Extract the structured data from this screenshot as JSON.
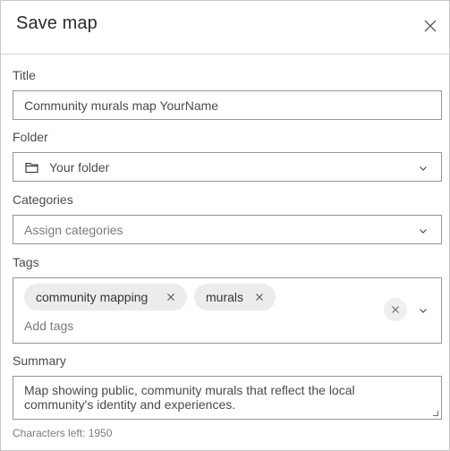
{
  "dialog": {
    "title": "Save map",
    "close_icon": "close-icon"
  },
  "form": {
    "title": {
      "label": "Title",
      "value": "Community murals map YourName"
    },
    "folder": {
      "label": "Folder",
      "icon": "folder-icon",
      "value": "Your folder"
    },
    "categories": {
      "label": "Categories",
      "placeholder": "Assign categories"
    },
    "tags": {
      "label": "Tags",
      "chips": [
        {
          "label": "community mapping"
        },
        {
          "label": "murals"
        }
      ],
      "placeholder": "Add tags"
    },
    "summary": {
      "label": "Summary",
      "value": "Map showing public, community murals that reflect the local community's identity and experiences.",
      "characters_left_label": "Characters left: 1950"
    }
  }
}
